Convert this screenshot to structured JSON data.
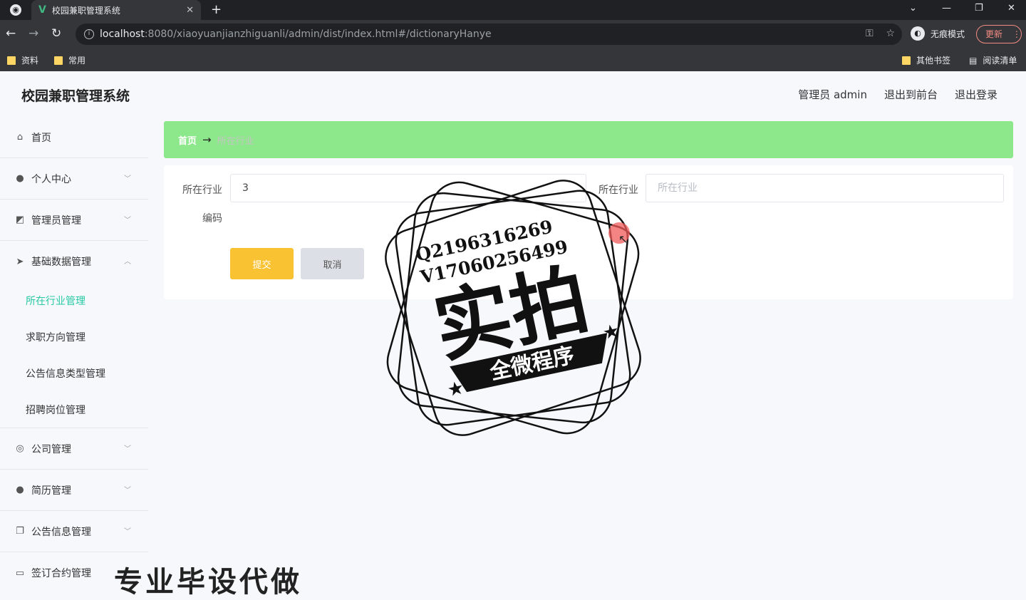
{
  "browser": {
    "tab_title": "校园兼职管理系统",
    "tab_logo": "V",
    "tab_close": "✕",
    "new_tab": "+",
    "url_host": "localhost",
    "url_rest": ":8080/xiaoyuanjianzhiguanli/admin/dist/index.html#/dictionaryHanye",
    "incognito_label": "无痕模式",
    "update_label": "更新",
    "bookmarks": [
      "资料",
      "常用"
    ],
    "bookmarks_right": [
      "其他书签",
      "阅读清单"
    ]
  },
  "header": {
    "title": "校园兼职管理系统",
    "admin_label": "管理员 admin",
    "to_front": "退出到前台",
    "logout": "退出登录"
  },
  "sidebar": {
    "items": [
      {
        "label": "首页",
        "icon": "home-icon"
      },
      {
        "label": "个人中心",
        "icon": "user-icon"
      },
      {
        "label": "管理员管理",
        "icon": "chart-icon"
      },
      {
        "label": "基础数据管理",
        "icon": "paper-plane-icon"
      }
    ],
    "submenu": [
      {
        "label": "所在行业管理",
        "active": true
      },
      {
        "label": "求职方向管理"
      },
      {
        "label": "公告信息类型管理"
      },
      {
        "label": "招聘岗位管理"
      }
    ],
    "items_after": [
      {
        "label": "公司管理",
        "icon": "compass-icon"
      },
      {
        "label": "简历管理",
        "icon": "person-icon"
      },
      {
        "label": "公告信息管理",
        "icon": "copy-icon"
      },
      {
        "label": "签订合约管理",
        "icon": "card-icon"
      }
    ]
  },
  "breadcrumb": {
    "home": "首页",
    "arrow": "→",
    "current": "所在行业"
  },
  "form": {
    "field1_label": "所在行业",
    "field1_value": "3",
    "field1_sublabel": "编码",
    "field2_label": "所在行业",
    "field2_placeholder": "所在行业",
    "submit": "提交",
    "cancel": "取消"
  },
  "watermark": {
    "line1": "Q2196316269",
    "line2": "V17060256499",
    "main": "实拍",
    "ribbon": "全微程序",
    "bottom": "专业毕设代做"
  },
  "colors": {
    "breadcrumb_bg": "#8ce88a",
    "active_menu": "#27c9a4",
    "submit_bg": "#f9c233",
    "cancel_bg": "#dcdfe5"
  }
}
